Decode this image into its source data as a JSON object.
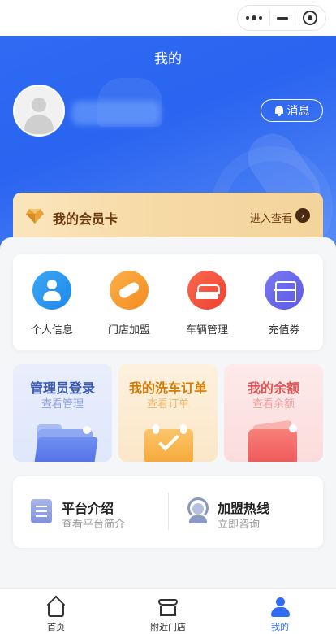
{
  "header": {
    "title": "我的",
    "message_label": "消息"
  },
  "colors": {
    "primary": "#2f6cf3",
    "member_text": "#6b3a0d"
  },
  "member_card": {
    "title": "我的会员卡",
    "enter_label": "进入查看",
    "arrow_icon": "chevron-right-icon"
  },
  "quick_menu": [
    {
      "label": "个人信息",
      "icon": "user-icon"
    },
    {
      "label": "门店加盟",
      "icon": "handshake-icon"
    },
    {
      "label": "车辆管理",
      "icon": "car-icon"
    },
    {
      "label": "充值券",
      "icon": "scan-icon"
    }
  ],
  "features": [
    {
      "title": "管理员登录",
      "subtitle": "查看管理",
      "icon": "folder-icon"
    },
    {
      "title": "我的洗车订单",
      "subtitle": "查看订单",
      "icon": "calendar-check-icon"
    },
    {
      "title": "我的余额",
      "subtitle": "查看余额",
      "icon": "wallet-icon"
    }
  ],
  "info": [
    {
      "title": "平台介绍",
      "subtitle": "查看平台简介",
      "icon": "document-icon"
    },
    {
      "title": "加盟热线",
      "subtitle": "立即咨询",
      "icon": "headset-icon"
    }
  ],
  "tabbar": [
    {
      "label": "首页",
      "icon": "home-icon",
      "active": false
    },
    {
      "label": "附近门店",
      "icon": "store-icon",
      "active": false
    },
    {
      "label": "我的",
      "icon": "person-icon",
      "active": true
    }
  ]
}
